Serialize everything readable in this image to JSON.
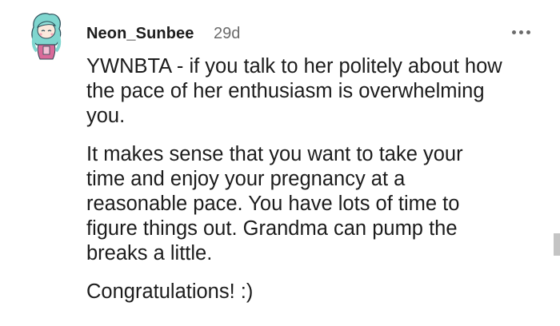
{
  "comment": {
    "username": "Neon_Sunbee",
    "timestamp": "29d",
    "more_icon": "more-horizontal-icon",
    "paragraphs": [
      "YWNBTA - if you talk to her politely about how\nthe pace of her enthusiasm is overwhelming\nyou.",
      "It makes sense that you want to take your\ntime and enjoy your pregnancy at a\nreasonable pace. You have lots of time to\nfigure things out. Grandma can pump the\nbreaks a little.",
      "Congratulations! :)"
    ]
  },
  "colors": {
    "text": "#1c1c1c",
    "muted": "#6b6b6b",
    "avatar_hair": "#7fd6cf",
    "avatar_outfit": "#d96b9a"
  }
}
